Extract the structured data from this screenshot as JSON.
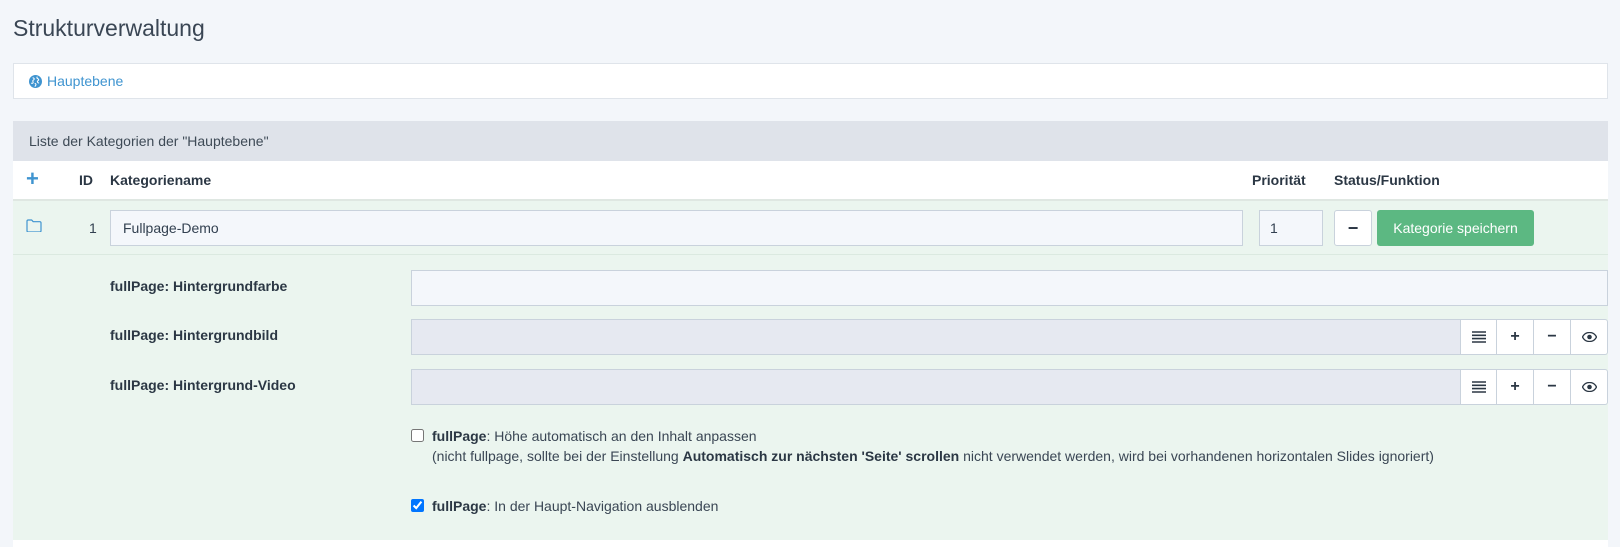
{
  "page": {
    "title": "Strukturverwaltung"
  },
  "breadcrumb": {
    "label": "Hauptebene"
  },
  "panel": {
    "heading": "Liste der Kategorien der \"Hauptebene\""
  },
  "table": {
    "add_symbol": "+",
    "headers": {
      "id": "ID",
      "name": "Kategoriename",
      "priority": "Priorität",
      "status": "Status/Funktion"
    },
    "row": {
      "id": "1",
      "name": "Fullpage-Demo",
      "priority": "1",
      "minus_symbol": "−",
      "save_label": "Kategorie speichern"
    }
  },
  "fields": [
    {
      "label": "fullPage: Hintergrundfarbe",
      "value": ""
    },
    {
      "label": "fullPage: Hintergrundbild",
      "value": ""
    },
    {
      "label": "fullPage: Hintergrund-Video",
      "value": ""
    }
  ],
  "media_buttons": {
    "plus": "+",
    "minus": "−"
  },
  "options": {
    "auto_height": {
      "checked": false,
      "prefix": "fullPage",
      "text": ": Höhe automatisch an den Inhalt anpassen",
      "note_before": "(nicht fullpage, sollte bei der Einstellung ",
      "note_bold": "Automatisch zur nächsten 'Seite' scrollen",
      "note_after": " nicht verwendet werden, wird bei vorhandenen horizontalen Slides ignoriert)"
    },
    "hide_nav": {
      "checked": true,
      "prefix": "fullPage",
      "text": ": In der Haupt-Navigation ausblenden"
    }
  },
  "icons": {
    "breadcrumb": "globe-icon",
    "row": "folder-icon",
    "media": [
      "list-icon",
      "plus-icon",
      "minus-icon",
      "eye-icon"
    ]
  },
  "colors": {
    "link": "#3f94d0",
    "success": "#5cb882",
    "row_bg": "#ebf5ef",
    "heading_bg": "#dfe3ea"
  }
}
